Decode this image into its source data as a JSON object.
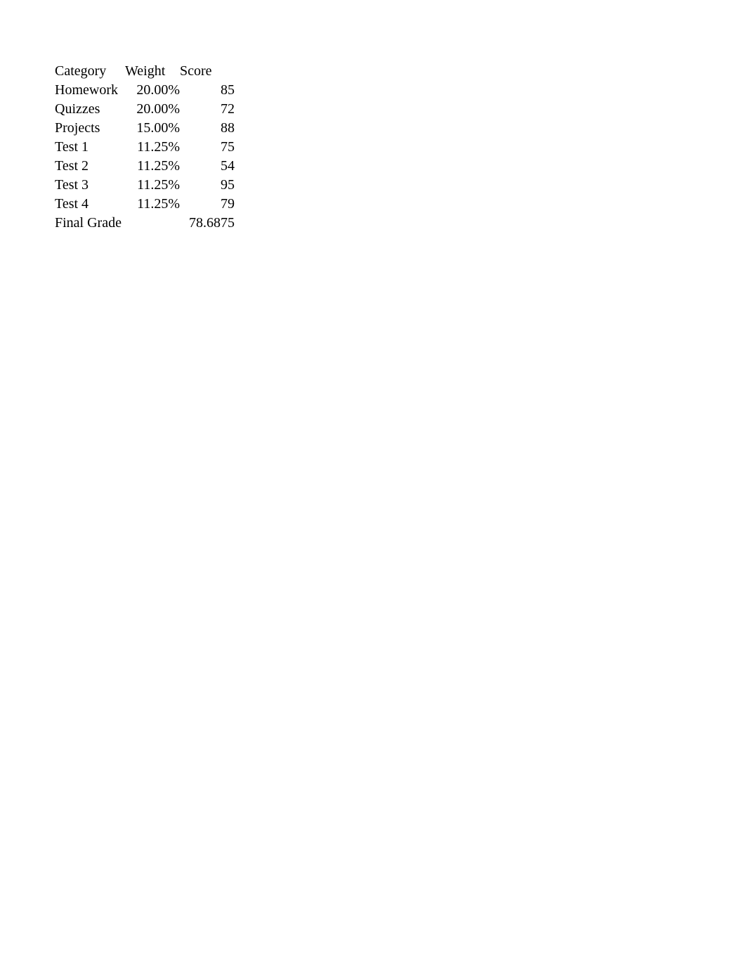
{
  "headers": {
    "category": "Category",
    "weight": "Weight",
    "score": "Score"
  },
  "rows": [
    {
      "category": "Homework",
      "weight": "20.00%",
      "score": "85"
    },
    {
      "category": "Quizzes",
      "weight": "20.00%",
      "score": "72"
    },
    {
      "category": "Projects",
      "weight": "15.00%",
      "score": "88"
    },
    {
      "category": "Test 1",
      "weight": "11.25%",
      "score": "75"
    },
    {
      "category": "Test 2",
      "weight": "11.25%",
      "score": "54"
    },
    {
      "category": "Test 3",
      "weight": "11.25%",
      "score": "95"
    },
    {
      "category": "Test 4",
      "weight": "11.25%",
      "score": "79"
    }
  ],
  "final": {
    "label": "Final Grade",
    "weight": "",
    "score": "78.6875"
  }
}
